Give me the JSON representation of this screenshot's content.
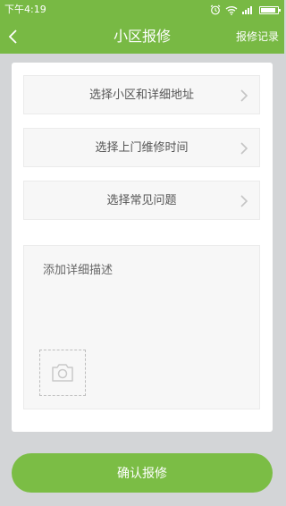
{
  "status_bar": {
    "time": "下午4:19",
    "battery_level": 0.9
  },
  "nav": {
    "title": "小区报修",
    "action_label": "报修记录"
  },
  "form": {
    "rows": [
      {
        "label": "选择小区和详细地址"
      },
      {
        "label": "选择上门维修时间"
      },
      {
        "label": "选择常见问题"
      }
    ],
    "description_placeholder": "添加详细描述"
  },
  "confirm_label": "确认报修",
  "colors": {
    "accent": "#78b944",
    "button": "#7bbd45",
    "page_bg": "#d3d5d7"
  }
}
